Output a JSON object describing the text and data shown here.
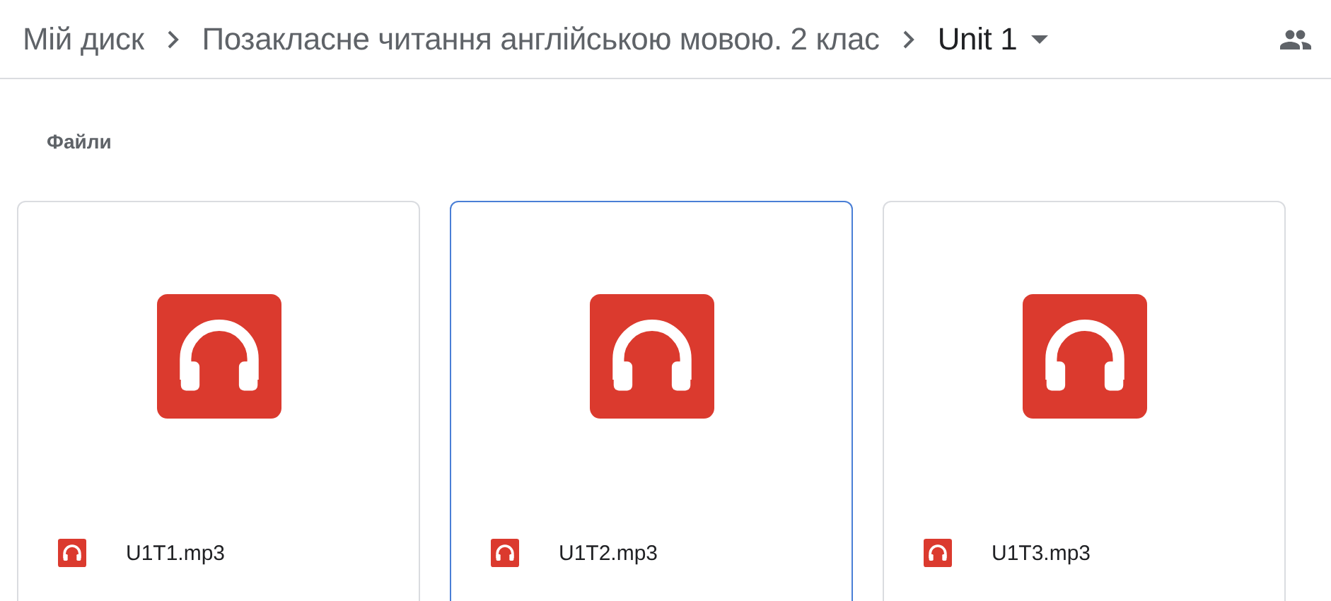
{
  "breadcrumb": [
    {
      "label": "Мій диск",
      "current": false
    },
    {
      "label": "Позакласне читання англійською мовою. 2 клас",
      "current": false
    },
    {
      "label": "Unit 1",
      "current": true
    }
  ],
  "section_title": "Файли",
  "files": [
    {
      "name": "U1T1.mp3",
      "selected": false
    },
    {
      "name": "U1T2.mp3",
      "selected": true
    },
    {
      "name": "U1T3.mp3",
      "selected": false
    }
  ]
}
